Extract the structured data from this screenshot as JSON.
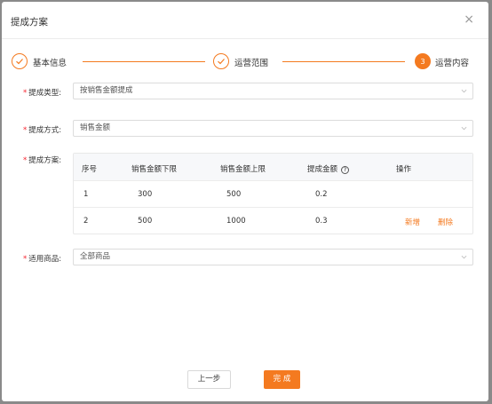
{
  "dialog": {
    "title": "提成方案",
    "close_glyph": "×"
  },
  "steps": [
    {
      "label": "基本信息",
      "status": "done"
    },
    {
      "label": "运营范围",
      "status": "done"
    },
    {
      "label": "运营内容",
      "status": "active",
      "number": "3"
    }
  ],
  "form": {
    "commission_type": {
      "label": "提成类型",
      "colon": ":",
      "value": "按销售金额提成"
    },
    "commission_method": {
      "label": "提成方式",
      "colon": ":",
      "value": "销售金额"
    },
    "commission_plan": {
      "label": "提成方案",
      "colon": ":"
    },
    "applicable_goods": {
      "label": "适用商品",
      "colon": ":",
      "value": "全部商品"
    }
  },
  "table": {
    "headers": [
      "序号",
      "销售金额下限",
      "销售金额上限",
      "提成金额",
      "操作"
    ],
    "rows": [
      {
        "index": "1",
        "lower": "300",
        "upper": "500",
        "amount": "0.2",
        "actions": []
      },
      {
        "index": "2",
        "lower": "500",
        "upper": "1000",
        "amount": "0.3",
        "actions": [
          "新增",
          "删除"
        ]
      }
    ]
  },
  "footer": {
    "prev_label": "上一步",
    "done_label": "完 成"
  },
  "colors": {
    "accent": "#f47a20",
    "required": "#f5222d"
  },
  "icons": [
    "close-icon",
    "check-icon",
    "chevron-down-icon",
    "question-circle-icon"
  ]
}
